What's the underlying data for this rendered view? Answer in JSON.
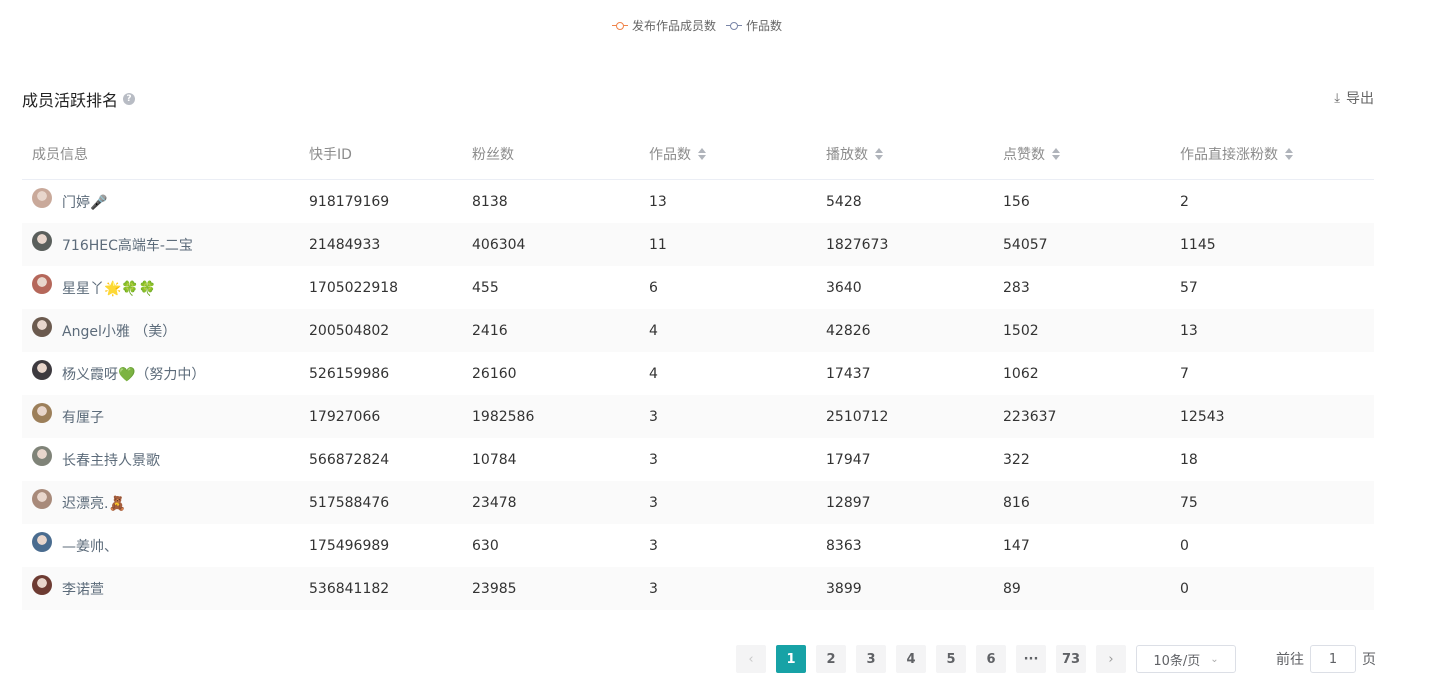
{
  "legend": [
    {
      "label": "发布作品成员数",
      "color": "#f0844a"
    },
    {
      "label": "作品数",
      "color": "#7a86a8"
    }
  ],
  "section": {
    "title": "成员活跃排名",
    "help_icon": "question-circle-icon",
    "export_label": "导出",
    "export_icon": "download-icon"
  },
  "table": {
    "columns": [
      {
        "label": "成员信息",
        "sortable": false
      },
      {
        "label": "快手ID",
        "sortable": false
      },
      {
        "label": "粉丝数",
        "sortable": false
      },
      {
        "label": "作品数",
        "sortable": true
      },
      {
        "label": "播放数",
        "sortable": true
      },
      {
        "label": "点赞数",
        "sortable": true
      },
      {
        "label": "作品直接涨粉数",
        "sortable": true
      }
    ],
    "rows": [
      {
        "name": "门婷🎤",
        "id": "918179169",
        "fans": "8138",
        "works": "13",
        "plays": "5428",
        "likes": "156",
        "gain": "2",
        "avatar_color": "#c9a99a"
      },
      {
        "name": "716HEC高端车-二宝",
        "id": "21484933",
        "fans": "406304",
        "works": "11",
        "plays": "1827673",
        "likes": "54057",
        "gain": "1145",
        "avatar_color": "#5a5f5c"
      },
      {
        "name": "星星丫🌟🍀🍀",
        "id": "1705022918",
        "fans": "455",
        "works": "6",
        "plays": "3640",
        "likes": "283",
        "gain": "57",
        "avatar_color": "#b5675a"
      },
      {
        "name": "Angel小雅 （美）",
        "id": "200504802",
        "fans": "2416",
        "works": "4",
        "plays": "42826",
        "likes": "1502",
        "gain": "13",
        "avatar_color": "#6b5a4e"
      },
      {
        "name": "杨义霞呀💚（努力中）",
        "id": "526159986",
        "fans": "26160",
        "works": "4",
        "plays": "17437",
        "likes": "1062",
        "gain": "7",
        "avatar_color": "#3d3a3f"
      },
      {
        "name": "有厘子",
        "id": "17927066",
        "fans": "1982586",
        "works": "3",
        "plays": "2510712",
        "likes": "223637",
        "gain": "12543",
        "avatar_color": "#9c7f5a"
      },
      {
        "name": "长春主持人景歌",
        "id": "566872824",
        "fans": "10784",
        "works": "3",
        "plays": "17947",
        "likes": "322",
        "gain": "18",
        "avatar_color": "#7f8378"
      },
      {
        "name": "迟漂亮.🧸",
        "id": "517588476",
        "fans": "23478",
        "works": "3",
        "plays": "12897",
        "likes": "816",
        "gain": "75",
        "avatar_color": "#a88a7a"
      },
      {
        "name": "—姜帅、",
        "id": "175496989",
        "fans": "630",
        "works": "3",
        "plays": "8363",
        "likes": "147",
        "gain": "0",
        "avatar_color": "#4a6c8f"
      },
      {
        "name": "李诺萱",
        "id": "536841182",
        "fans": "23985",
        "works": "3",
        "plays": "3899",
        "likes": "89",
        "gain": "0",
        "avatar_color": "#6d3b32"
      }
    ]
  },
  "pagination": {
    "prev_icon": "chevron-left-icon",
    "next_icon": "chevron-right-icon",
    "pages": [
      "1",
      "2",
      "3",
      "4",
      "5",
      "6",
      "···",
      "73"
    ],
    "current": "1",
    "page_size": "10条/页",
    "goto_prefix": "前往",
    "goto_value": "1",
    "goto_suffix": "页"
  }
}
